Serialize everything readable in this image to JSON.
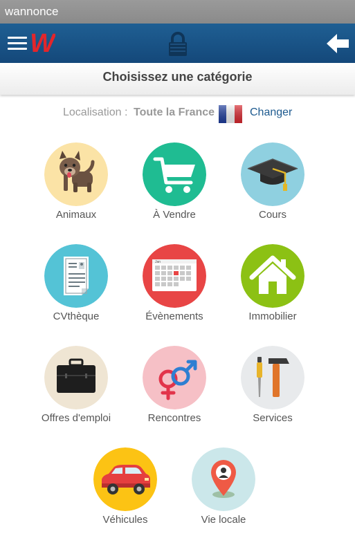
{
  "window_title": "wannonce",
  "header": {
    "logo_letter": "W",
    "icons": {
      "menu": "hamburger-menu-icon",
      "lock": "lock-icon",
      "back": "back-arrow-icon"
    }
  },
  "category_bar": {
    "title": "Choisissez une catégorie"
  },
  "location": {
    "label": "Localisation :",
    "value": "Toute la France",
    "flag_icon": "french-flag-icon",
    "change_label": "Changer"
  },
  "categories": [
    {
      "label": "Animaux",
      "icon": "dog-icon",
      "color": "#fbe3a6"
    },
    {
      "label": "À Vendre",
      "icon": "shopping-cart-icon",
      "color": "#1fbc92"
    },
    {
      "label": "Cours",
      "icon": "graduation-cap-icon",
      "color": "#8fd0e0"
    },
    {
      "label": "CVthèque",
      "icon": "resume-document-icon",
      "color": "#54c3d6"
    },
    {
      "label": "Évènements",
      "icon": "calendar-icon",
      "color": "#e84545"
    },
    {
      "label": "Immobilier",
      "icon": "house-icon",
      "color": "#8cc114"
    },
    {
      "label": "Offres d'emploi",
      "icon": "briefcase-icon",
      "color": "#efe5d3"
    },
    {
      "label": "Rencontres",
      "icon": "gender-symbols-icon",
      "color": "#f6c0c6"
    },
    {
      "label": "Services",
      "icon": "tools-icon",
      "color": "#e8eaec"
    },
    {
      "label": "Véhicules",
      "icon": "car-icon",
      "color": "#fcc314"
    },
    {
      "label": "Vie locale",
      "icon": "location-pin-icon",
      "color": "#cbe7ea"
    }
  ]
}
